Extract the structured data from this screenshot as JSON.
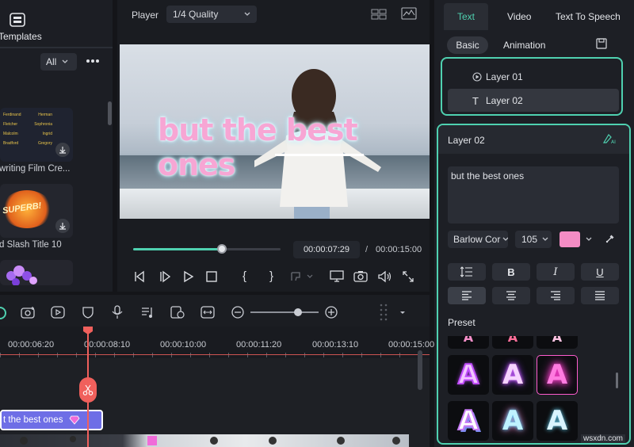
{
  "left_panel": {
    "title": "Templates",
    "filter": "All",
    "items": [
      {
        "label": "writing Film Cre..."
      },
      {
        "label": "d Slash Title 10"
      }
    ],
    "superb_text": "SUPERB!",
    "credits_rows": [
      [
        "Ferdinand",
        "Herman"
      ],
      [
        "Fletcher",
        "Sophronia"
      ],
      [
        "Malcolm",
        "Ingrid"
      ],
      [
        "Bradford",
        "Gregory"
      ]
    ]
  },
  "player": {
    "label": "Player",
    "quality": "1/4 Quality",
    "overlay_text": "but the best ones",
    "current_time": "00:00:07:29",
    "separator": "/",
    "total_time": "00:00:15:00",
    "progress": 0.6
  },
  "right_panel": {
    "tabs": [
      "Text",
      "Video",
      "Text To Speech"
    ],
    "subtabs": [
      "Basic",
      "Animation"
    ],
    "layers": [
      {
        "label": "Layer 01"
      },
      {
        "label": "Layer 02"
      }
    ],
    "section_title": "Layer 02",
    "text_content": "but the best ones",
    "font": "Barlow Cor",
    "size": "105",
    "color": "#f48cc4",
    "format_buttons": [
      "I",
      "B",
      "I",
      "U"
    ],
    "preset_label": "Preset"
  },
  "timeline": {
    "ticks": [
      "00:00:06:20",
      "00:00:08:10",
      "00:00:10:00",
      "00:00:11:20",
      "00:00:13:10",
      "00:00:15:00"
    ],
    "clip_text": "t the best ones",
    "zoom_level": 0.7
  },
  "watermark": "wsxdn.com",
  "colors": {
    "accent": "#4fd1b0",
    "pink": "#f48cc4",
    "clip": "#6e6ee6",
    "playhead": "#f0605c"
  }
}
